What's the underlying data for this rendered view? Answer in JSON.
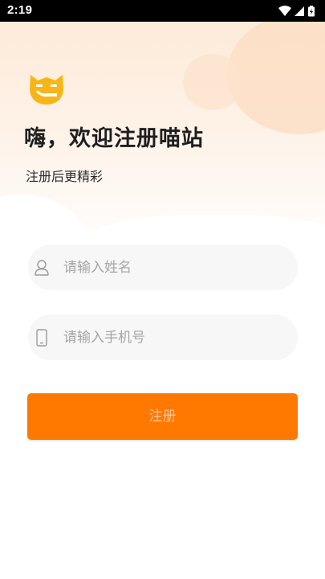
{
  "status_bar": {
    "time": "2:19",
    "icons": [
      "wifi-icon",
      "cellular-signal-icon",
      "battery-icon"
    ]
  },
  "header": {
    "logo_icon": "cat-logo-icon",
    "title": "嗨，欢迎注册喵站",
    "subtitle": "注册后更精彩"
  },
  "form": {
    "name_field": {
      "icon": "user-icon",
      "placeholder": "请输入姓名",
      "value": ""
    },
    "phone_field": {
      "icon": "phone-icon",
      "placeholder": "请输入手机号",
      "value": ""
    },
    "submit_label": "注册"
  },
  "colors": {
    "accent": "#ff7900",
    "logo_yellow": "#f6b617",
    "header_bg": "#fdebd9",
    "placeholder": "#a5a5a5",
    "button_text": "#ffc79c"
  }
}
